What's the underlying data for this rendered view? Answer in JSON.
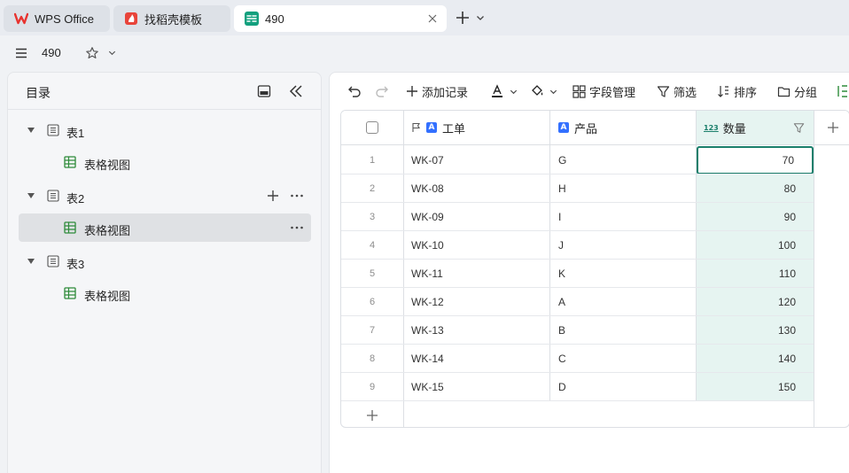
{
  "app": {
    "tabs": [
      {
        "label": "WPS Office",
        "icon": "wps-logo-icon",
        "active": false
      },
      {
        "label": "找稻壳模板",
        "icon": "docer-icon",
        "active": false
      },
      {
        "label": "490",
        "icon": "multidim-table-icon",
        "active": true
      }
    ]
  },
  "subbar": {
    "title": "490"
  },
  "sidebar": {
    "title": "目录",
    "tree": [
      {
        "label": "表1",
        "level": 1
      },
      {
        "label": "表格视图",
        "level": 2
      },
      {
        "label": "表2",
        "level": 1
      },
      {
        "label": "表格视图",
        "level": 2,
        "selected": true
      },
      {
        "label": "表3",
        "level": 1
      },
      {
        "label": "表格视图",
        "level": 2
      }
    ]
  },
  "toolbar": {
    "add_record": "添加记录",
    "field_manage": "字段管理",
    "filter": "筛选",
    "sort": "排序",
    "group": "分组"
  },
  "grid": {
    "columns": [
      {
        "label": "工单",
        "type_glyph": "A"
      },
      {
        "label": "产品",
        "type_glyph": "A"
      },
      {
        "label": "数量",
        "type_glyph": "123"
      }
    ],
    "rows": [
      {
        "n": "1",
        "order": "WK-07",
        "product": "G",
        "qty": "70"
      },
      {
        "n": "2",
        "order": "WK-08",
        "product": "H",
        "qty": "80"
      },
      {
        "n": "3",
        "order": "WK-09",
        "product": "I",
        "qty": "90"
      },
      {
        "n": "4",
        "order": "WK-10",
        "product": "J",
        "qty": "100"
      },
      {
        "n": "5",
        "order": "WK-11",
        "product": "K",
        "qty": "110"
      },
      {
        "n": "6",
        "order": "WK-12",
        "product": "A",
        "qty": "120"
      },
      {
        "n": "7",
        "order": "WK-13",
        "product": "B",
        "qty": "130"
      },
      {
        "n": "8",
        "order": "WK-14",
        "product": "C",
        "qty": "140"
      },
      {
        "n": "9",
        "order": "WK-15",
        "product": "D",
        "qty": "150"
      }
    ]
  },
  "colors": {
    "accent": "#1a7f6b",
    "qty_bg": "#e6f4f1",
    "field_blue": "#3370ff"
  }
}
